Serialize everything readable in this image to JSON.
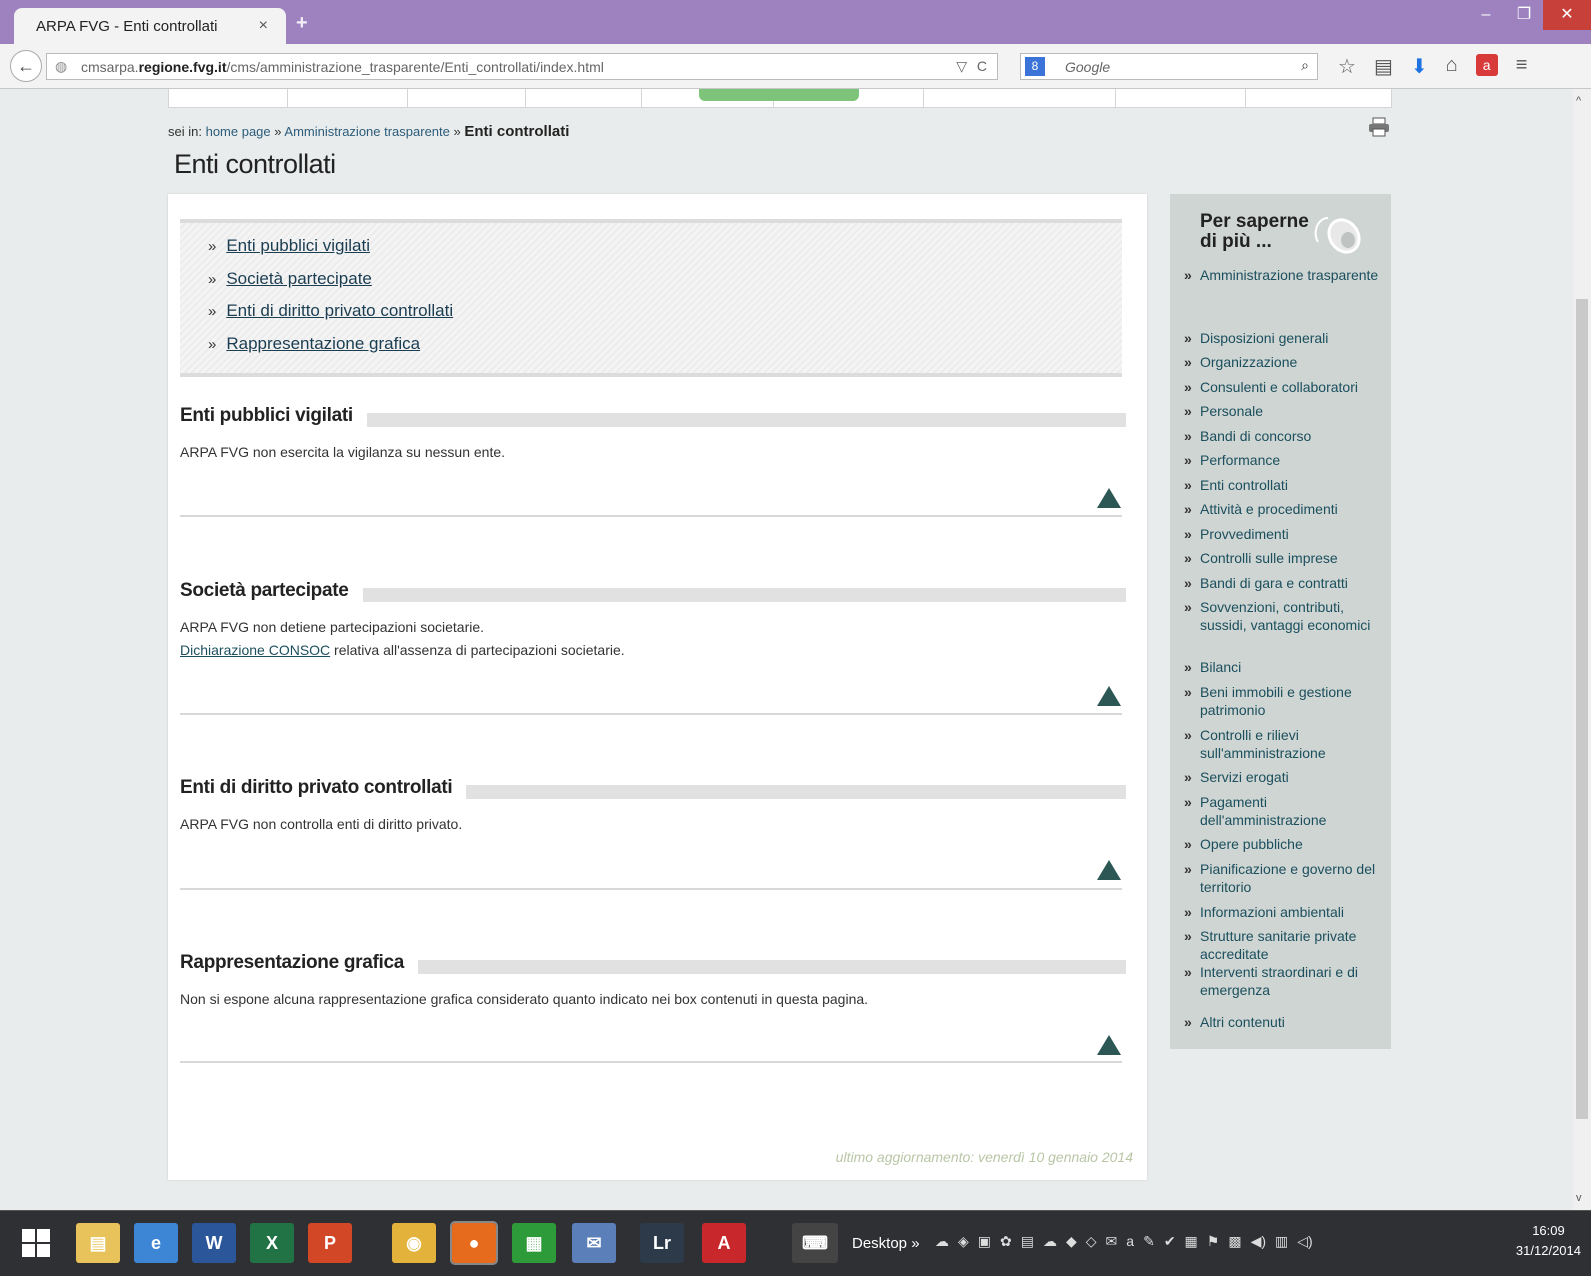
{
  "browser": {
    "tab_title": "ARPA FVG - Enti controllati",
    "tab_close": "×",
    "new_tab": "+",
    "url_prefix": "cmsarpa.",
    "url_domain": "regione.fvg.it",
    "url_path": "/cms/amministrazione_trasparente/Enti_controllati/index.html",
    "search_engine_badge": "8",
    "search_placeholder": "Google",
    "icons": [
      "back-arrow-icon",
      "globe-icon",
      "dropdown-icon",
      "reload-icon",
      "search-icon",
      "star-icon",
      "reading-list-icon",
      "download-icon",
      "home-icon",
      "acrobat-icon",
      "menu-icon"
    ]
  },
  "breadcrumb": {
    "prefix": "sei in:",
    "home": "home page",
    "sep": "»",
    "parent": "Amministrazione trasparente",
    "current": "Enti controllati"
  },
  "page": {
    "title": "Enti controllati",
    "toc": [
      {
        "label": "Enti pubblici vigilati"
      },
      {
        "label": "Società partecipate"
      },
      {
        "label": "Enti di diritto privato controllati"
      },
      {
        "label": "Rappresentazione grafica"
      }
    ],
    "sections": [
      {
        "title": "Enti pubblici vigilati",
        "text": "ARPA FVG non esercita la vigilanza su nessun ente."
      },
      {
        "title": "Società partecipate",
        "text": "ARPA FVG non detiene partecipazioni societarie.",
        "link": "Dichiarazione CONSOC",
        "link_suffix": " relativa all'assenza di partecipazioni societarie."
      },
      {
        "title": "Enti di diritto privato controllati",
        "text": "ARPA FVG non controlla enti di diritto privato."
      },
      {
        "title": "Rappresentazione grafica",
        "text": "Non si espone alcuna rappresentazione grafica considerato quanto indicato nei box contenuti in questa pagina."
      }
    ],
    "last_update": "ultimo aggiornamento: venerdì 10 gennaio 2014"
  },
  "sidebar": {
    "heading_line1": "Per saperne",
    "heading_line2": "di più ...",
    "items": [
      {
        "label": "Amministrazione trasparente"
      },
      {
        "label": "Disposizioni generali"
      },
      {
        "label": "Organizzazione"
      },
      {
        "label": "Consulenti e collaboratori"
      },
      {
        "label": "Personale"
      },
      {
        "label": "Bandi di concorso"
      },
      {
        "label": "Performance"
      },
      {
        "label": "Enti controllati"
      },
      {
        "label": "Attività e procedimenti"
      },
      {
        "label": "Provvedimenti"
      },
      {
        "label": "Controlli sulle imprese"
      },
      {
        "label": "Bandi di gara e contratti"
      },
      {
        "label": "Sovvenzioni, contributi, sussidi, vantaggi economici"
      },
      {
        "label": "Bilanci"
      },
      {
        "label": "Beni immobili e gestione patrimonio"
      },
      {
        "label": "Controlli e rilievi sull'amministrazione"
      },
      {
        "label": "Servizi erogati"
      },
      {
        "label": "Pagamenti dell'amministrazione"
      },
      {
        "label": "Opere pubbliche"
      },
      {
        "label": "Pianificazione e governo del territorio"
      },
      {
        "label": "Informazioni ambientali"
      },
      {
        "label": "Strutture sanitarie private accreditate"
      },
      {
        "label": "Interventi straordinari e di emergenza"
      },
      {
        "label": "Altri contenuti"
      }
    ]
  },
  "taskbar": {
    "desktop_label": "Desktop",
    "overflow": "»",
    "time": "16:09",
    "date": "31/12/2014",
    "apps": [
      {
        "name": "file-explorer-icon",
        "glyph": "▤",
        "color": "#e8c25a"
      },
      {
        "name": "internet-explorer-icon",
        "glyph": "e",
        "color": "#3d86d6"
      },
      {
        "name": "word-icon",
        "glyph": "W",
        "color": "#2b579a"
      },
      {
        "name": "excel-icon",
        "glyph": "X",
        "color": "#217346"
      },
      {
        "name": "powerpoint-icon",
        "glyph": "P",
        "color": "#d24726"
      },
      {
        "name": "chrome-icon",
        "glyph": "◉",
        "color": "#e2b23a"
      },
      {
        "name": "firefox-icon",
        "glyph": "●",
        "color": "#e66b1c"
      },
      {
        "name": "store-icon",
        "glyph": "▦",
        "color": "#2d9b3a"
      },
      {
        "name": "thunderbird-icon",
        "glyph": "✉",
        "color": "#5b7fb8"
      },
      {
        "name": "lightroom-icon",
        "glyph": "Lr",
        "color": "#2d3a4a"
      },
      {
        "name": "acrobat-icon",
        "glyph": "A",
        "color": "#c8272b"
      }
    ]
  },
  "colors": {
    "accent": "#1b4f5e",
    "titlebar": "#9d82bf",
    "sidebar": "#cfd5d2",
    "arrow": "#2c5754"
  }
}
